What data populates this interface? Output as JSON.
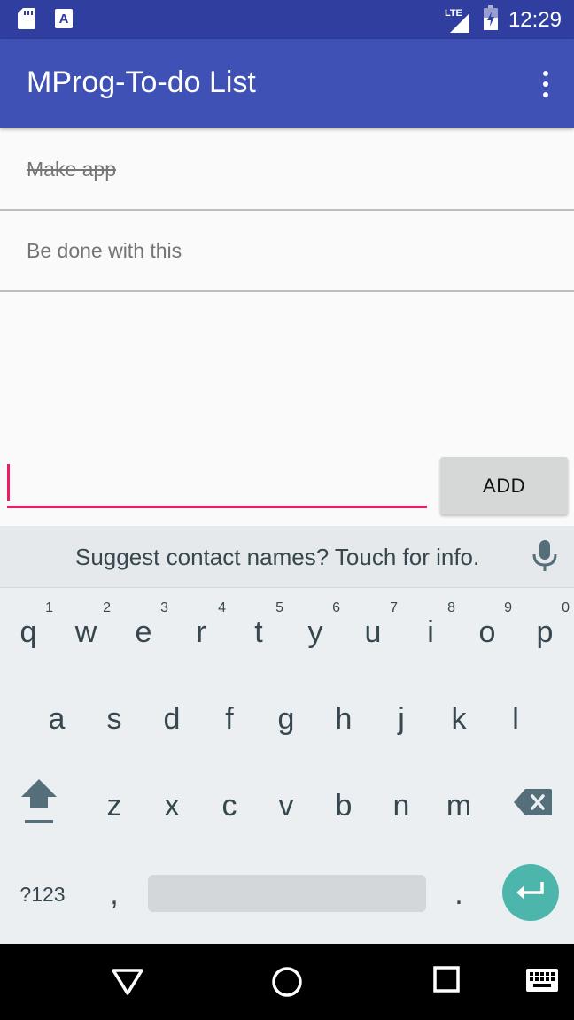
{
  "status_bar": {
    "time": "12:29",
    "network": "LTE"
  },
  "app_bar": {
    "title": "MProg-To-do List",
    "overflow_icon": "more-vert-icon"
  },
  "todos": [
    {
      "text": "Make app",
      "done": true
    },
    {
      "text": "Be done with this",
      "done": false
    }
  ],
  "input": {
    "value": "",
    "placeholder": ""
  },
  "add_button": {
    "label": "ADD"
  },
  "keyboard": {
    "suggestion": "Suggest contact names? Touch for info.",
    "row1": [
      {
        "ch": "q",
        "hint": "1"
      },
      {
        "ch": "w",
        "hint": "2"
      },
      {
        "ch": "e",
        "hint": "3"
      },
      {
        "ch": "r",
        "hint": "4"
      },
      {
        "ch": "t",
        "hint": "5"
      },
      {
        "ch": "y",
        "hint": "6"
      },
      {
        "ch": "u",
        "hint": "7"
      },
      {
        "ch": "i",
        "hint": "8"
      },
      {
        "ch": "o",
        "hint": "9"
      },
      {
        "ch": "p",
        "hint": "0"
      }
    ],
    "row2": [
      "a",
      "s",
      "d",
      "f",
      "g",
      "h",
      "j",
      "k",
      "l"
    ],
    "row3": [
      "z",
      "x",
      "c",
      "v",
      "b",
      "n",
      "m"
    ],
    "symbols_label": "?123",
    "comma": ",",
    "period": "."
  },
  "colors": {
    "primary": "#3f51b5",
    "primary_dark": "#303f9f",
    "accent": "#e91e63",
    "enter": "#4db6ac"
  }
}
